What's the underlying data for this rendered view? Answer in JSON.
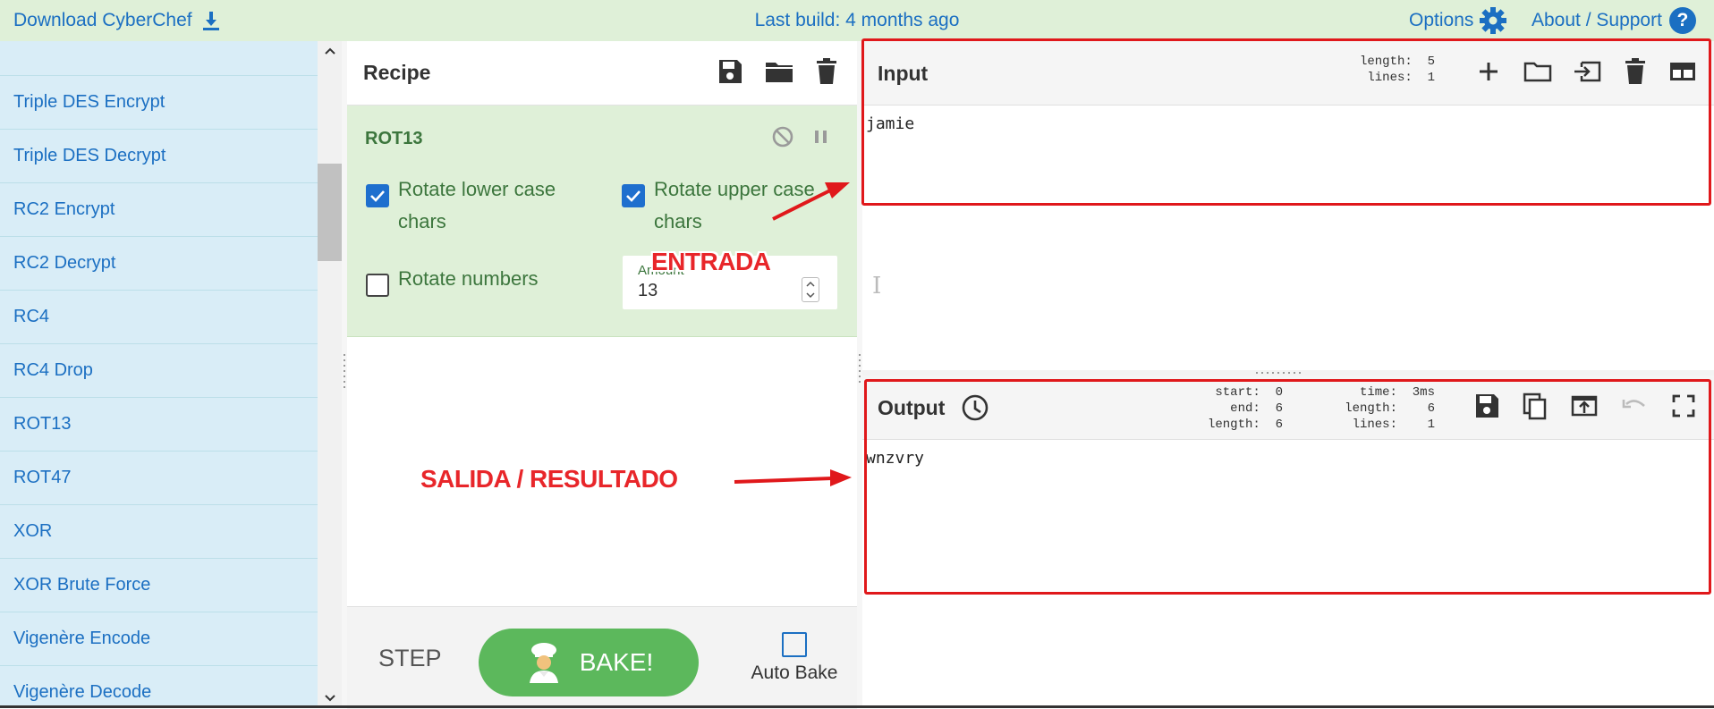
{
  "banner": {
    "download_label": "Download CyberChef",
    "build_label": "Last build: 4 months ago",
    "options_label": "Options",
    "about_label": "About / Support",
    "about_icon_text": "?"
  },
  "operations": {
    "items": [
      "Triple DES Encrypt",
      "Triple DES Decrypt",
      "RC2 Encrypt",
      "RC2 Decrypt",
      "RC4",
      "RC4 Drop",
      "ROT13",
      "ROT47",
      "XOR",
      "XOR Brute Force",
      "Vigenère Encode",
      "Vigenère Decode"
    ]
  },
  "recipe": {
    "title": "Recipe",
    "operation": {
      "name": "ROT13",
      "rotate_lower_label": "Rotate lower case chars",
      "rotate_lower_checked": true,
      "rotate_upper_label": "Rotate upper case chars",
      "rotate_upper_checked": true,
      "rotate_numbers_label": "Rotate numbers",
      "rotate_numbers_checked": false,
      "amount_label": "Amount",
      "amount_value": "13"
    },
    "controls": {
      "step_label": "STEP",
      "bake_label": "BAKE!",
      "auto_bake_label": "Auto Bake",
      "auto_bake_checked": false
    }
  },
  "input": {
    "title": "Input",
    "stats": {
      "length_label": "length:",
      "length": "5",
      "lines_label": "lines:",
      "lines": "1"
    },
    "text": "jamie"
  },
  "output": {
    "title": "Output",
    "stats": {
      "start_label": "start:",
      "start": "0",
      "time_label": "time:",
      "time": "3ms",
      "end_label": "end:",
      "end": "6",
      "length_label": "length:",
      "length": "6",
      "sel_length_label": "length:",
      "sel_length": "6",
      "lines_label": "lines:",
      "lines": "1"
    },
    "text": "wnzvry"
  },
  "annotations": {
    "entrada": "ENTRADA",
    "salida": "SALIDA / RESULTADO",
    "color": "#e0181b"
  },
  "colors": {
    "banner_bg": "#dff0d8",
    "link": "#1b6fc2",
    "ops_bg": "#d9edf7",
    "recipe_op_bg": "#dff0d8",
    "recipe_op_text": "#3c763d",
    "bake_button": "#5cb85c",
    "checkbox_on": "#1e6fce"
  }
}
